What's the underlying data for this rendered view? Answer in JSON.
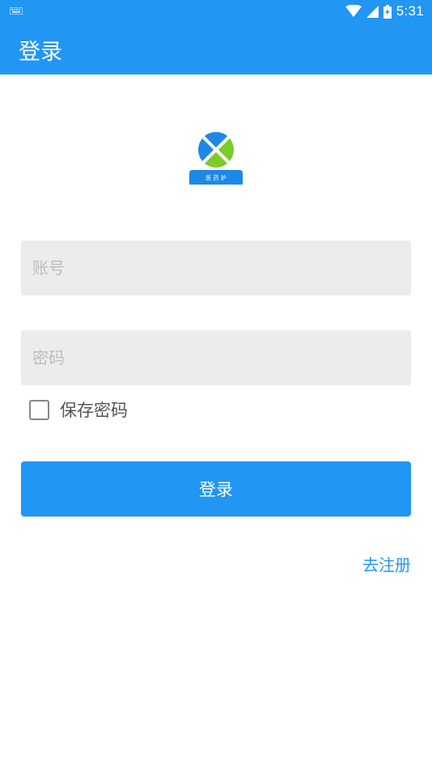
{
  "status_bar": {
    "time": "5:31",
    "icons": [
      "keyboard-icon",
      "wifi-icon",
      "signal-icon",
      "battery-icon"
    ]
  },
  "app_bar": {
    "title": "登录"
  },
  "logo": {
    "text": "医 药 护",
    "colors": {
      "blue": "#1E88E5",
      "green": "#7CCB2B",
      "banner": "#1E88E5"
    }
  },
  "form": {
    "account_placeholder": "账号",
    "account_value": "",
    "password_placeholder": "密码",
    "password_value": "",
    "save_password_label": "保存密码",
    "save_password_checked": false
  },
  "buttons": {
    "login_label": "登录",
    "register_label": "去注册"
  },
  "colors": {
    "primary": "#2196F3",
    "input_bg": "#ececec",
    "placeholder": "#bdbdbd"
  }
}
